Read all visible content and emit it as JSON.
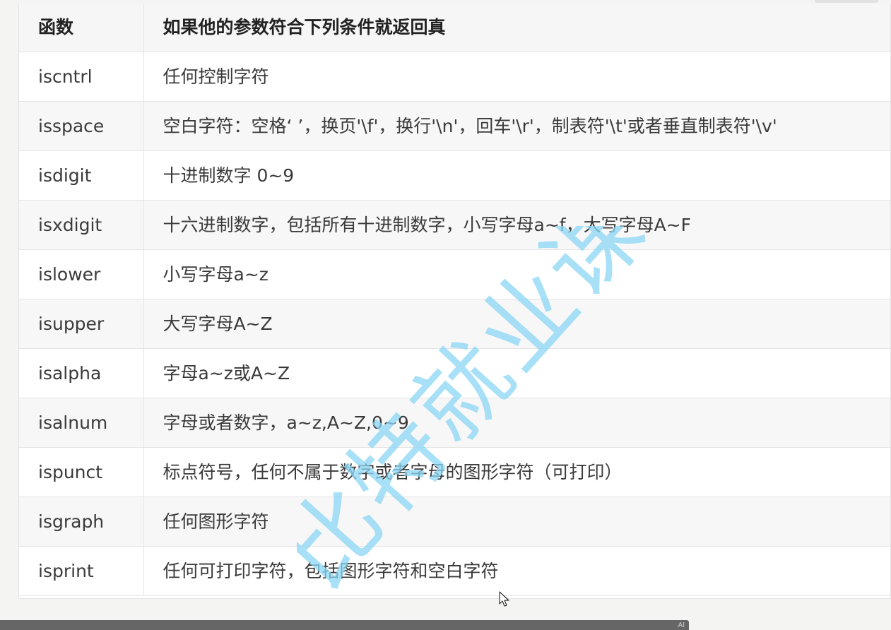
{
  "table": {
    "headers": {
      "function": "函数",
      "condition": "如果他的参数符合下列条件就返回真"
    },
    "rows": [
      {
        "func": "iscntrl",
        "desc": "任何控制字符"
      },
      {
        "func": "isspace",
        "desc": "空白字符：空格‘ ’，换页'\\f'，换行'\\n'，回车'\\r'，制表符'\\t'或者垂直制表符'\\v'"
      },
      {
        "func": "isdigit",
        "desc": "十进制数字 0~9"
      },
      {
        "func": "isxdigit",
        "desc": "十六进制数字，包括所有十进制数字，小写字母a~f，大写字母A~F"
      },
      {
        "func": "islower",
        "desc": "小写字母a~z"
      },
      {
        "func": "isupper",
        "desc": "大写字母A~Z"
      },
      {
        "func": "isalpha",
        "desc": "字母a~z或A~Z"
      },
      {
        "func": "isalnum",
        "desc": "字母或者数字，a~z,A~Z,0~9"
      },
      {
        "func": "ispunct",
        "desc": "标点符号，任何不属于数字或者字母的图形字符（可打印）"
      },
      {
        "func": "isgraph",
        "desc": "任何图形字符"
      },
      {
        "func": "isprint",
        "desc": "任何可打印字符，包括图形字符和空白字符"
      }
    ]
  },
  "watermark": {
    "text": "比特就业课",
    "color": "#7fd0f0"
  },
  "overlay": {
    "ai_label": "AI",
    "cursor_icon": "mouse-pointer-icon"
  }
}
